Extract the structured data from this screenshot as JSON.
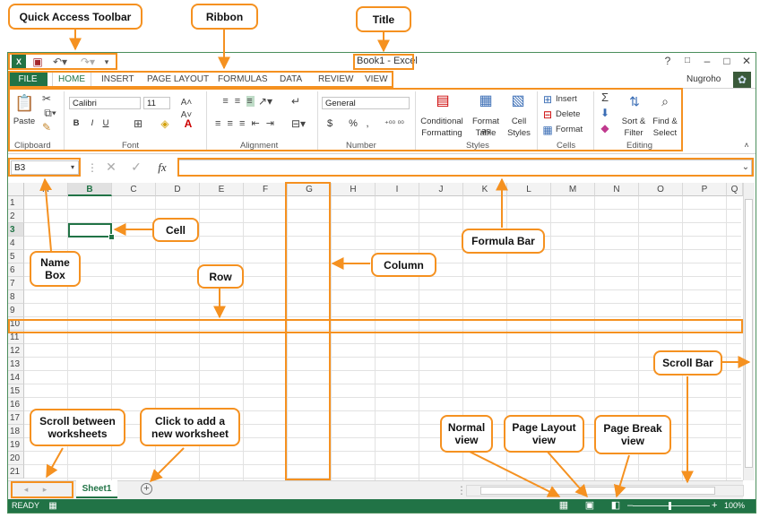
{
  "window": {
    "title": "Book1 - Excel",
    "user": "Nugroho",
    "help_symbol": "?",
    "restore_symbol": "□",
    "minimize_symbol": "–",
    "maximize_symbol": "□",
    "close_symbol": "✕",
    "accent_color": "#217346"
  },
  "quick_access": {
    "icons": [
      "excel-logo-icon",
      "save-icon",
      "undo-icon",
      "redo-icon",
      "customize-icon"
    ]
  },
  "tabs": [
    "FILE",
    "HOME",
    "INSERT",
    "PAGE LAYOUT",
    "FORMULAS",
    "DATA",
    "REVIEW",
    "VIEW"
  ],
  "active_tab": "HOME",
  "ribbon": {
    "clipboard": {
      "label": "Clipboard",
      "paste": "Paste"
    },
    "font": {
      "label": "Font",
      "name": "Calibri",
      "size": "11",
      "bold": "B",
      "italic": "I",
      "underline": "U"
    },
    "alignment": {
      "label": "Alignment"
    },
    "number": {
      "label": "Number",
      "format": "General",
      "currency": "$",
      "percent": "%",
      "comma": ","
    },
    "styles": {
      "label": "Styles",
      "conditional_line1": "Conditional",
      "conditional_line2": "Formatting",
      "format_table_line1": "Format as",
      "format_table_line2": "Table",
      "cell_styles_line1": "Cell",
      "cell_styles_line2": "Styles"
    },
    "cells": {
      "label": "Cells",
      "insert": "Insert",
      "delete": "Delete",
      "format": "Format"
    },
    "editing": {
      "label": "Editing",
      "sort_line1": "Sort &",
      "sort_line2": "Filter",
      "find_line1": "Find &",
      "find_line2": "Select"
    }
  },
  "formula_bar": {
    "name_box": "B3",
    "fx": "fx",
    "value": ""
  },
  "grid": {
    "columns": [
      "A",
      "B",
      "C",
      "D",
      "E",
      "F",
      "G",
      "H",
      "I",
      "J",
      "K",
      "L",
      "M",
      "N",
      "O",
      "P",
      "Q"
    ],
    "rows": [
      "1",
      "2",
      "3",
      "4",
      "5",
      "6",
      "7",
      "8",
      "9",
      "10",
      "11",
      "12",
      "13",
      "14",
      "15",
      "16",
      "17",
      "18",
      "19",
      "20",
      "21"
    ],
    "selected_cell": "B3"
  },
  "sheets": {
    "tabs": [
      "Sheet1"
    ],
    "add_symbol": "+"
  },
  "status": {
    "state": "READY",
    "zoom": "100%"
  },
  "annotations": {
    "quick_access": "Quick Access Toolbar",
    "ribbon": "Ribbon",
    "title": "Title",
    "cell": "Cell",
    "formula_bar": "Formula Bar",
    "name_box_line1": "Name",
    "name_box_line2": "Box",
    "column": "Column",
    "row": "Row",
    "scroll_bar": "Scroll Bar",
    "scroll_sheets_line1": "Scroll between",
    "scroll_sheets_line2": "worksheets",
    "add_sheet_line1": "Click to add a",
    "add_sheet_line2": "new worksheet",
    "normal_line1": "Normal",
    "normal_line2": "view",
    "page_layout_line1": "Page Layout",
    "page_layout_line2": "view",
    "page_break_line1": "Page Break",
    "page_break_line2": "view",
    "highlight_color": "#f59120"
  }
}
